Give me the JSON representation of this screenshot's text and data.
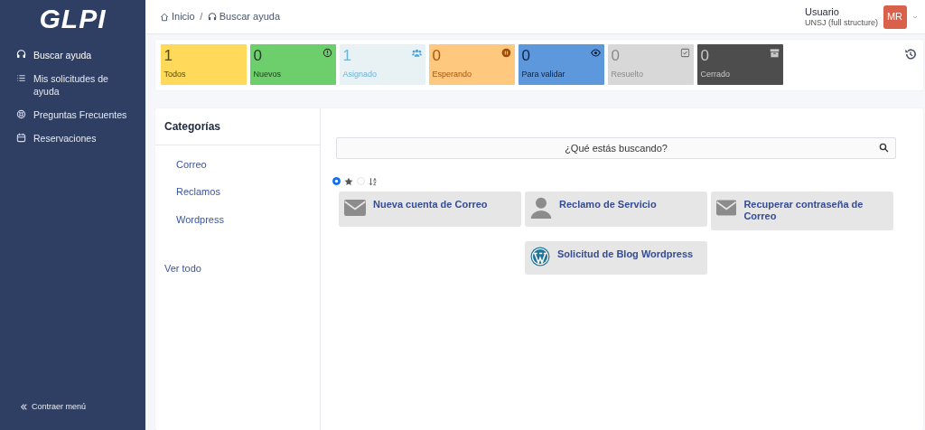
{
  "sidebar": {
    "logo": "GLPI",
    "items": [
      {
        "label": "Buscar ayuda",
        "kind": "headset",
        "selected": true
      },
      {
        "label": "Mis solicitudes de ayuda",
        "kind": "list",
        "selected": false
      },
      {
        "label": "Preguntas Frecuentes",
        "kind": "lifebuoy",
        "selected": false
      },
      {
        "label": "Reservaciones",
        "kind": "calendar",
        "selected": false
      }
    ],
    "collapse": "Contraer menú"
  },
  "breadcrumb_separator": "/",
  "breadcrumb": [
    {
      "label": "Inicio",
      "kind": "home"
    },
    {
      "label": "Buscar ayuda",
      "kind": "headset"
    }
  ],
  "user": {
    "name": "Usuario",
    "entity": "UNSJ (full structure)",
    "initials": "MR"
  },
  "tiles": [
    {
      "count": "1",
      "label": "Todos",
      "kind": "all",
      "color": "#ffd95a"
    },
    {
      "count": "0",
      "label": "Nuevos",
      "kind": "new",
      "color": "#6ccf6b"
    },
    {
      "count": "1",
      "label": "Asignado",
      "kind": "assigned",
      "color": "#e8f2f5"
    },
    {
      "count": "0",
      "label": "Esperando",
      "kind": "waiting",
      "color": "#ffc87f"
    },
    {
      "count": "0",
      "label": "Para validar",
      "kind": "validate",
      "color": "#5e98dc"
    },
    {
      "count": "0",
      "label": "Resuelto",
      "kind": "solved",
      "color": "#d8d8d8"
    },
    {
      "count": "0",
      "label": "Cerrado",
      "kind": "closed",
      "color": "#4d4d4d"
    }
  ],
  "categories": {
    "title": "Categorías",
    "items": [
      "Correo",
      "Reclamos",
      "Wordpress"
    ],
    "see_all": "Ver todo"
  },
  "search": {
    "placeholder": "¿Qué estás buscando?"
  },
  "sort_options": [
    {
      "kind": "star",
      "selected": true
    },
    {
      "kind": "alpha",
      "selected": false
    }
  ],
  "forms": [
    {
      "title": "Nueva cuenta de Correo",
      "kind": "mail"
    },
    {
      "title": "Reclamo de Servicio",
      "kind": "person"
    },
    {
      "title": "Recuperar contraseña de Correo",
      "kind": "mail"
    },
    {
      "title": "Solicitud de Blog Wordpress",
      "kind": "wordpress"
    }
  ]
}
